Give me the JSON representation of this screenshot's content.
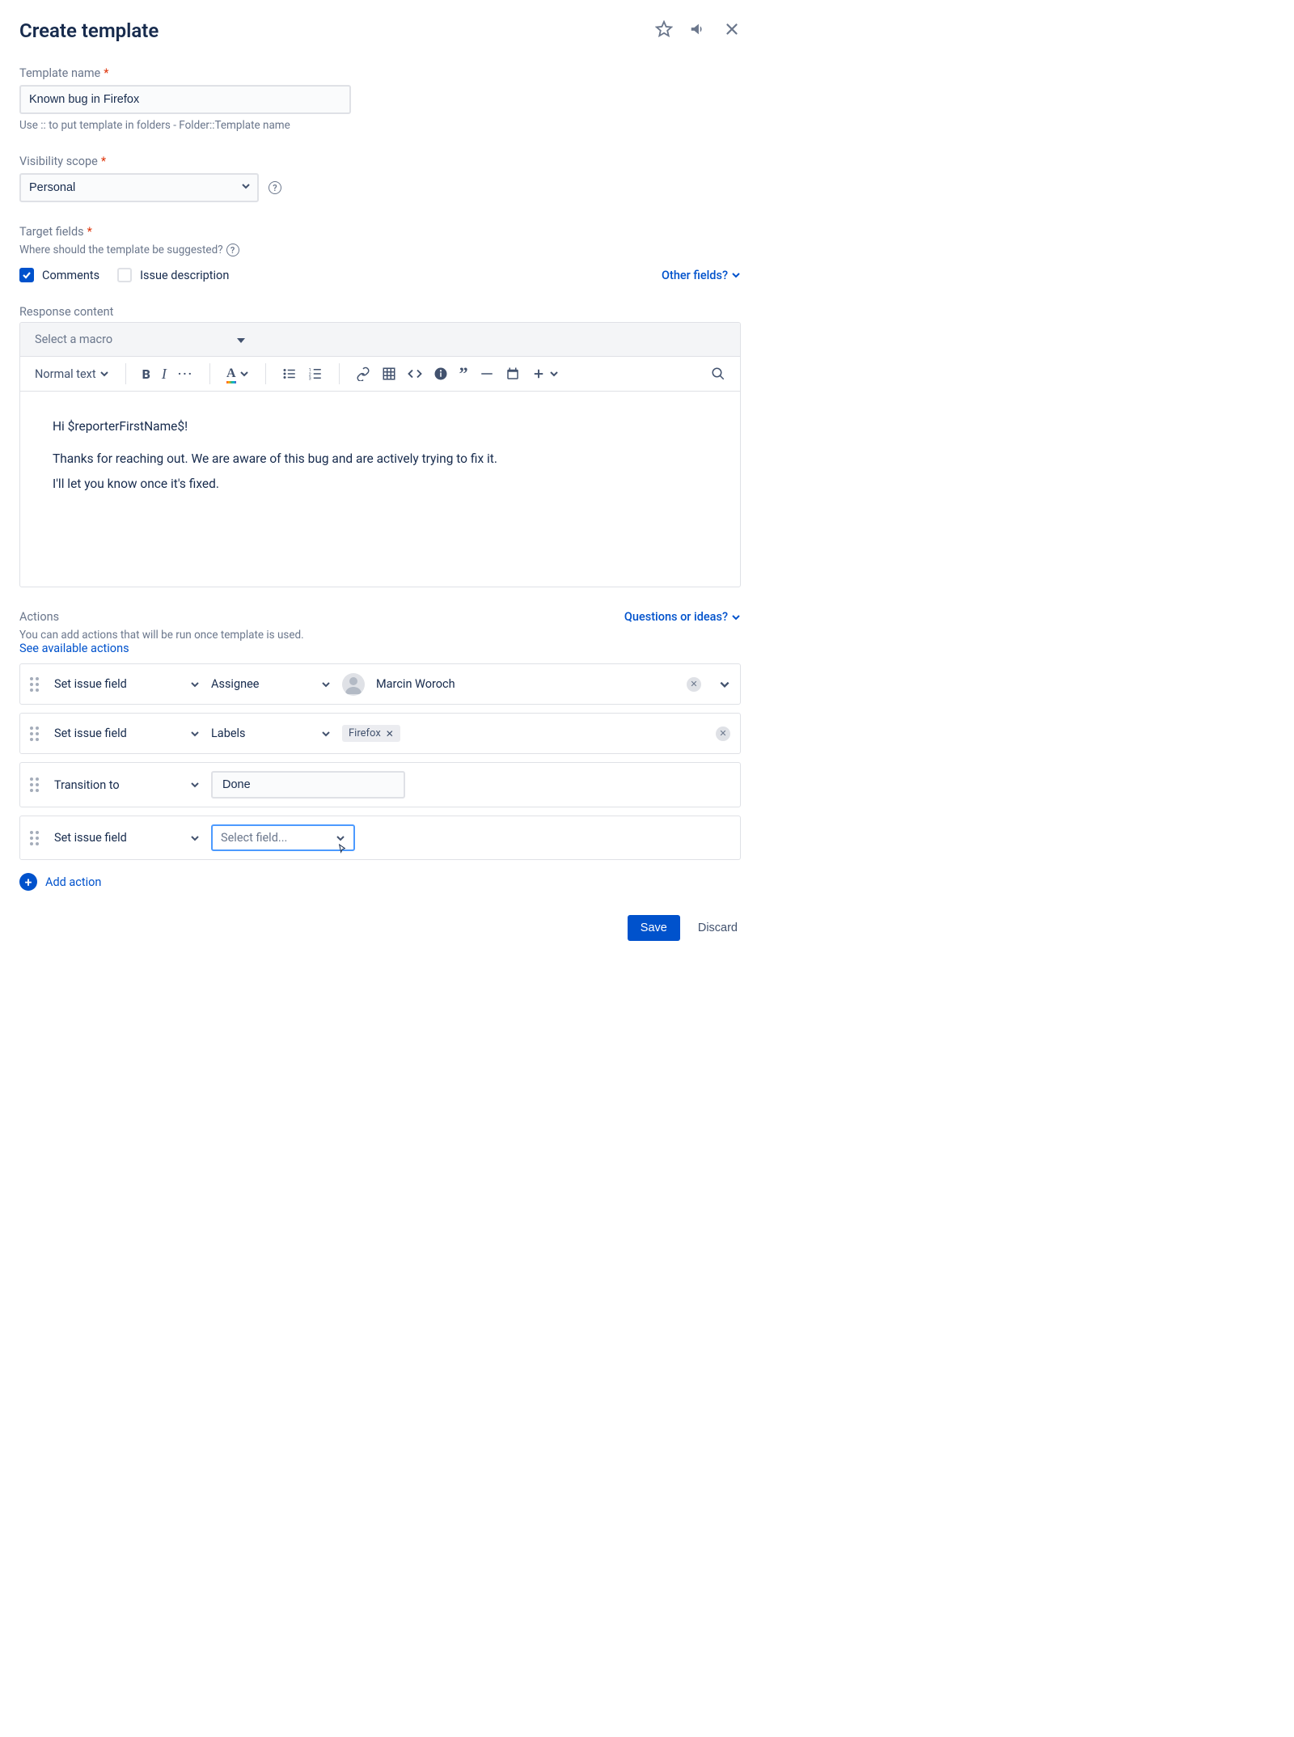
{
  "header": {
    "title": "Create template"
  },
  "templateName": {
    "label": "Template name",
    "value": "Known bug in Firefox",
    "hint": "Use :: to put template in folders - Folder::Template name"
  },
  "visibilityScope": {
    "label": "Visibility scope",
    "value": "Personal"
  },
  "targetFields": {
    "label": "Target fields",
    "hint": "Where should the template be suggested?",
    "comments": "Comments",
    "issueDescription": "Issue description",
    "otherFields": "Other fields?"
  },
  "responseContent": {
    "label": "Response content",
    "macroPlaceholder": "Select a macro",
    "toolbar": {
      "textStyle": "Normal text"
    },
    "body": {
      "p1": "Hi $reporterFirstName$!",
      "p2": "Thanks for reaching out. We are aware of this bug and are actively trying to fix it.",
      "p3": "I'll let you know once it's fixed."
    }
  },
  "actions": {
    "label": "Actions",
    "hint": "You can add actions that will be run once template is used.",
    "seeAvailable": "See available actions",
    "questions": "Questions or ideas?",
    "rows": [
      {
        "type": "Set issue field",
        "field": "Assignee",
        "user": "Marcin Woroch"
      },
      {
        "type": "Set issue field",
        "field": "Labels",
        "tag": "Firefox"
      },
      {
        "type": "Transition to",
        "status": "Done"
      },
      {
        "type": "Set issue field",
        "placeholder": "Select field..."
      }
    ],
    "addAction": "Add action"
  },
  "footer": {
    "save": "Save",
    "discard": "Discard"
  }
}
